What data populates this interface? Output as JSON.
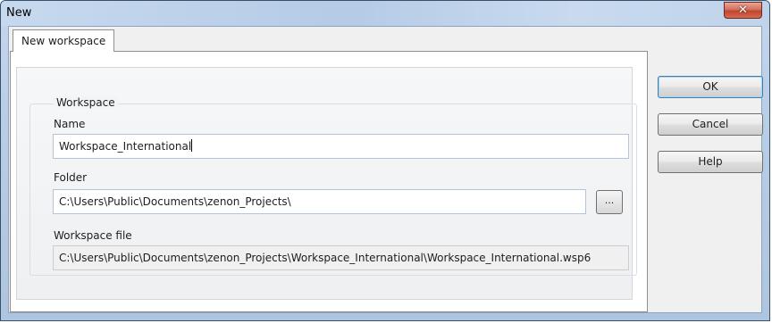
{
  "window": {
    "title": "New",
    "close_symbol": "✕"
  },
  "tabs": [
    {
      "label": "New workspace",
      "active": true
    }
  ],
  "group": {
    "label": "Workspace"
  },
  "fields": {
    "name": {
      "label": "Name",
      "value": "Workspace_International"
    },
    "folder": {
      "label": "Folder",
      "value": "C:\\Users\\Public\\Documents\\zenon_Projects\\",
      "browse_label": "..."
    },
    "workspace_file": {
      "label": "Workspace file",
      "value": "C:\\Users\\Public\\Documents\\zenon_Projects\\Workspace_International\\Workspace_International.wsp6"
    }
  },
  "buttons": {
    "ok": "OK",
    "cancel": "Cancel",
    "help": "Help"
  },
  "colors": {
    "titlebar": "#b9cfe8",
    "close_button": "#c7513b",
    "dialog_background": "#f0f0f0"
  }
}
